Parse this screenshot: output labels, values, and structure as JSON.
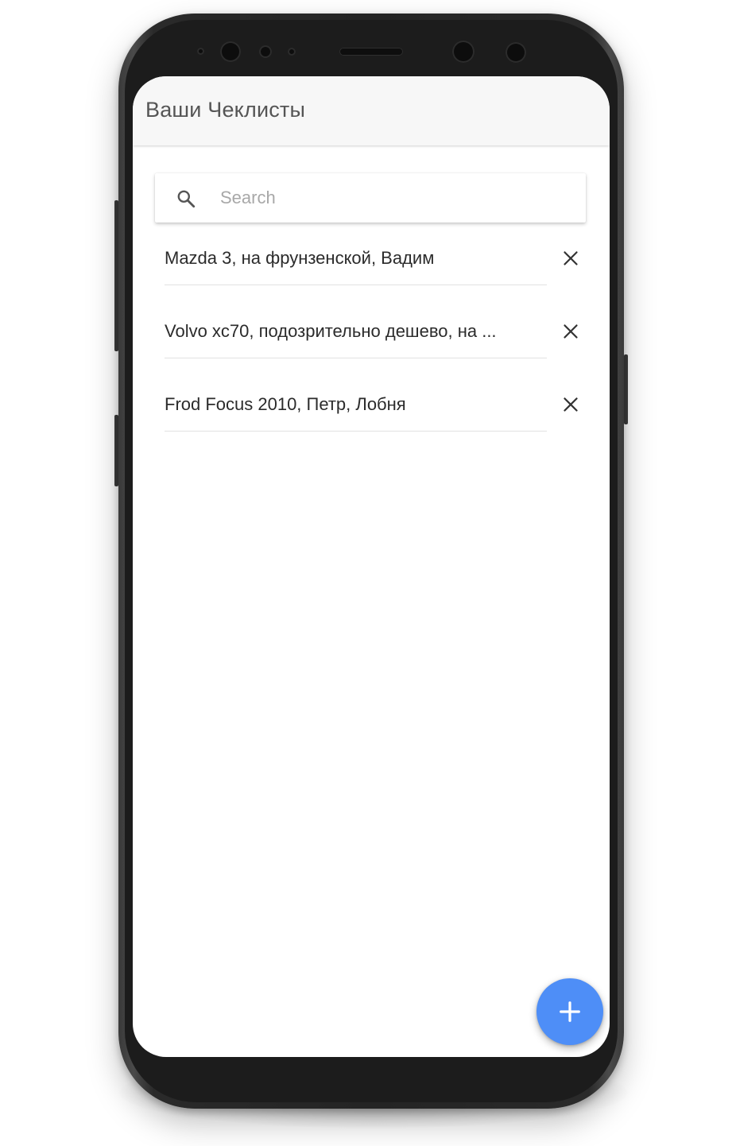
{
  "appbar": {
    "title": "Ваши Чеклисты"
  },
  "search": {
    "placeholder": "Search",
    "value": "",
    "icon": "search-icon"
  },
  "checklists": [
    {
      "label": "Mazda 3, на фрунзенской, Вадим",
      "remove_icon": "close-icon"
    },
    {
      "label": "Volvo xc70, подозрительно дешево, на ...",
      "remove_icon": "close-icon"
    },
    {
      "label": "Frod Focus 2010, Петр, Лобня",
      "remove_icon": "close-icon"
    }
  ],
  "fab": {
    "icon": "plus-icon",
    "color": "#4e8ef7"
  },
  "colors": {
    "appbar_bg": "#f7f7f7",
    "title_text": "#555555",
    "item_text": "#2b2b2b",
    "accent": "#4e8ef7"
  }
}
